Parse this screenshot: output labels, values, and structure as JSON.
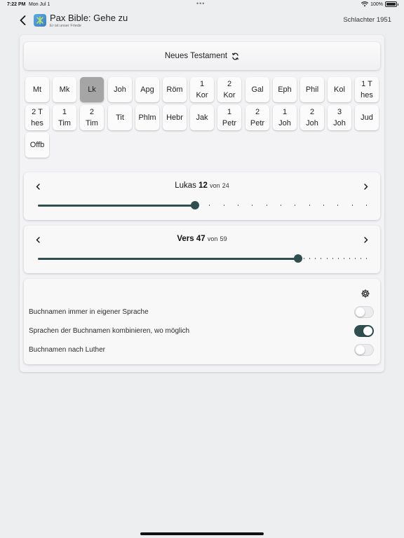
{
  "status": {
    "time": "7:22 PM",
    "date": "Mon Jul 1",
    "battery": "100%"
  },
  "nav": {
    "title": "Pax Bible: Gehe zu",
    "subtitle": "Er ist unser Friede",
    "version": "Schlachter 1951"
  },
  "testament": {
    "label": "Neues Testament"
  },
  "books": [
    "Mt",
    "Mk",
    "Lk",
    "Joh",
    "Apg",
    "Röm",
    "1\nKor",
    "2\nKor",
    "Gal",
    "Eph",
    "Phil",
    "Kol",
    "1 T\nhes",
    "2 T\nhes",
    "1\nTim",
    "2\nTim",
    "Tit",
    "Phlm",
    "Hebr",
    "Jak",
    "1\nPetr",
    "2\nPetr",
    "1\nJoh",
    "2\nJoh",
    "3\nJoh",
    "Jud",
    "Offb"
  ],
  "selected_book_index": 2,
  "chapter": {
    "book": "Lukas",
    "current": 12,
    "von": "von",
    "total": 24
  },
  "verse": {
    "label": "Vers",
    "current": 47,
    "von": "von",
    "total": 59
  },
  "settings": [
    {
      "label": "Buchnamen immer in eigener Sprache",
      "on": false
    },
    {
      "label": "Sprachen der Buchnamen kombinieren, wo möglich",
      "on": true
    },
    {
      "label": "Buchnamen nach Luther",
      "on": false
    }
  ],
  "colors": {
    "accent": "#2f4f4f",
    "selected_book": "#a5a5a5",
    "background": "#edeef0"
  },
  "icons": {
    "back": "chevron-left-icon",
    "refresh": "refresh-icon",
    "settings": "gear-icon"
  }
}
